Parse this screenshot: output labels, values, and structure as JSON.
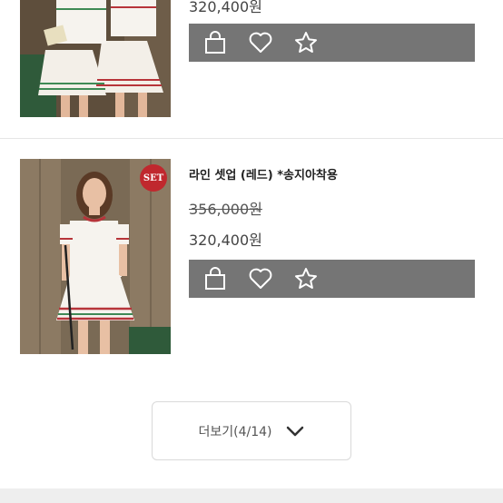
{
  "products": [
    {
      "name": "",
      "price_sale": "320,400원",
      "image_alt": "두 모델이 흰색 니트 셋업을 입은 상품 사진",
      "actions": {
        "cart_icon": "shopping-bag-icon",
        "wish_icon": "heart-icon",
        "star_icon": "star-icon"
      }
    },
    {
      "name": "라인 셋업 (레드) *송지아착용",
      "price_original": "356,000원",
      "price_sale": "320,400원",
      "badge": "SET",
      "actions": {
        "cart_icon": "shopping-bag-icon",
        "wish_icon": "heart-icon",
        "star_icon": "star-icon"
      }
    }
  ],
  "load_more": {
    "label": "더보기(4/14)",
    "icon": "chevron-down-icon"
  },
  "colors": {
    "action_bar": "#757575",
    "badge": "#c0282e",
    "stripe_red": "#b7343a",
    "stripe_green": "#3f8a55"
  }
}
